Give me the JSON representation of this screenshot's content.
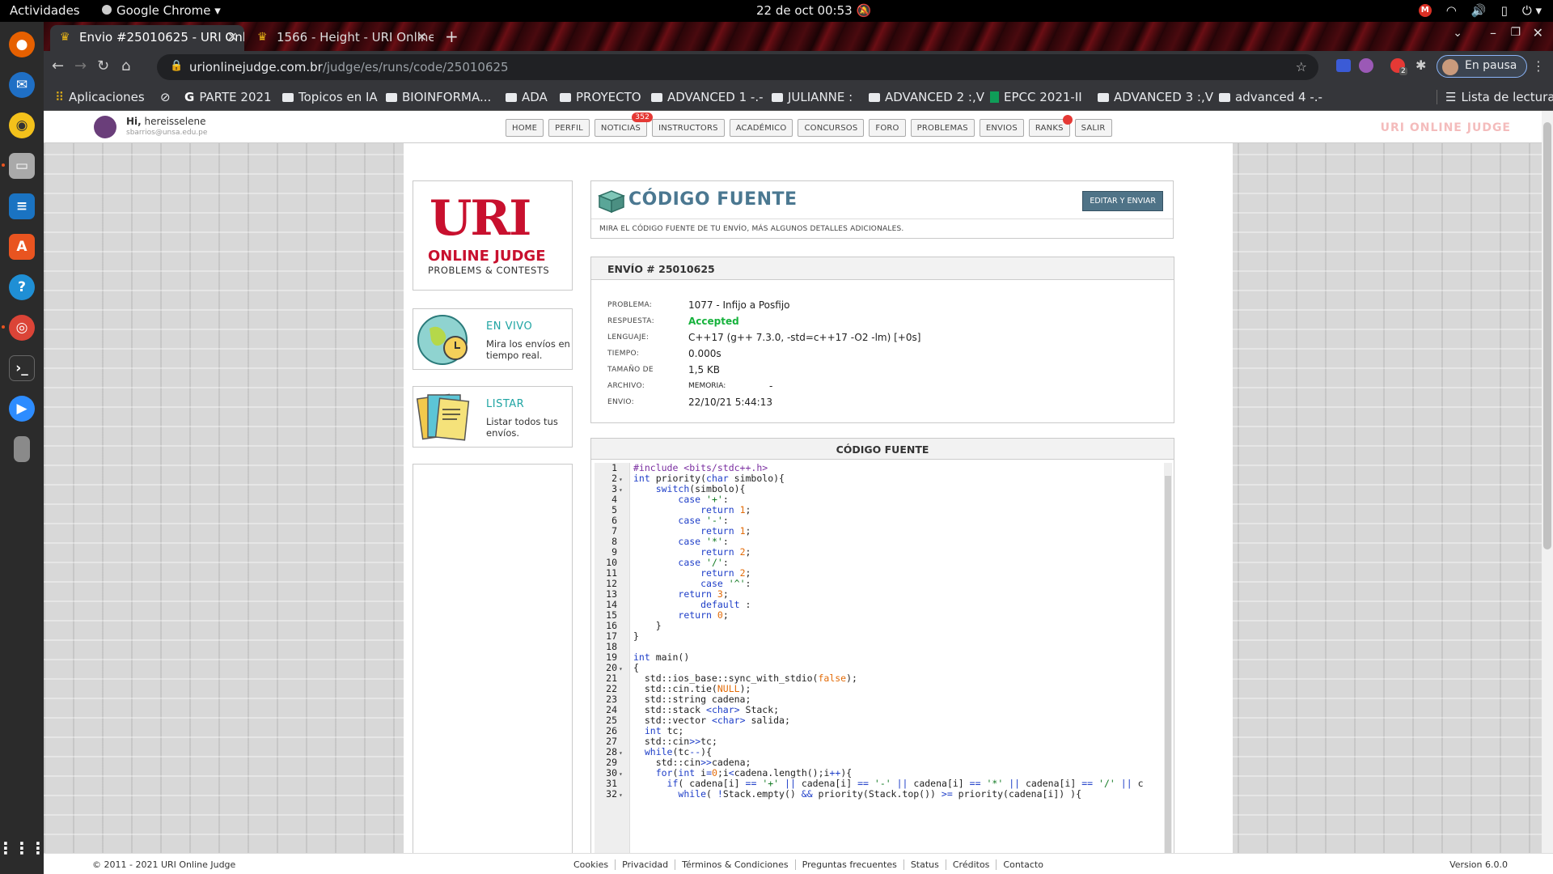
{
  "system": {
    "activities": "Actividades",
    "app_name": "Google Chrome",
    "datetime": "22 de oct  00:53"
  },
  "dock": {
    "items": [
      "firefox-icon",
      "thunderbird-icon",
      "rhythmbox-icon",
      "files-icon",
      "libreoffice-writer-icon",
      "software-icon",
      "help-icon",
      "chrome-icon",
      "terminal-icon",
      "zoom-icon",
      "removable-drive-icon",
      "show-apps-icon"
    ],
    "colors": {
      "firefox": "#e66000",
      "thunderbird": "#1f6fc5",
      "rhythmbox": "#f3c11b",
      "files": "#a9a9a9",
      "writer": "#1a73c2",
      "software": "#e95420",
      "help": "#1f8fd5",
      "chrome": "#db4437",
      "terminal": "#2e2e2e",
      "zoom": "#2d8cff",
      "drive": "#8a8a8a"
    }
  },
  "browser": {
    "tabs": [
      {
        "title": "Envio #25010625 - URI Onl",
        "active": true
      },
      {
        "title": "1566 - Height - URI Online",
        "active": false
      }
    ],
    "url_host": "urionlinejudge.com.br",
    "url_path": "/judge/es/runs/code/25010625",
    "profile_label": "En pausa",
    "extension_badge": "2",
    "bookmarks": [
      {
        "label": "Aplicaciones",
        "icon": "apps-grid-icon"
      },
      {
        "label": "",
        "icon": "globe-icon"
      },
      {
        "label": "PARTE 2021",
        "icon": "google-icon"
      },
      {
        "label": "Topicos en IA",
        "icon": "folder-icon"
      },
      {
        "label": "BIOINFORMA...",
        "icon": "folder-icon"
      },
      {
        "label": "ADA",
        "icon": "folder-icon"
      },
      {
        "label": "PROYECTO",
        "icon": "folder-icon"
      },
      {
        "label": "ADVANCED 1 -.-",
        "icon": "folder-icon"
      },
      {
        "label": "JULIANNE :",
        "icon": "folder-icon"
      },
      {
        "label": "ADVANCED 2 :,V",
        "icon": "folder-icon"
      },
      {
        "label": "EPCC 2021-II",
        "icon": "sheets-icon"
      },
      {
        "label": "ADVANCED 3 :,V",
        "icon": "folder-icon"
      },
      {
        "label": "advanced 4 -.-",
        "icon": "folder-icon"
      }
    ],
    "reading_list": "Lista de lectura"
  },
  "site": {
    "user_greeting": "Hi,",
    "username": "hereisselene",
    "email": "sbarrios@unsa.edu.pe",
    "nav": [
      "HOME",
      "PERFIL",
      "NOTICIAS",
      "INSTRUCTORS",
      "ACADÉMICO",
      "CONCURSOS",
      "FORO",
      "PROBLEMAS",
      "ENVIOS",
      "RANKS",
      "SALIR"
    ],
    "news_badge": "352",
    "brand": "URI ONLINE JUDGE",
    "logo": {
      "big": "URI",
      "line1": "ONLINE JUDGE",
      "line2": "PROBLEMS & CONTESTS"
    },
    "live": {
      "title": "EN VIVO",
      "desc": "Mira los envíos en tiempo real."
    },
    "list": {
      "title": "LISTAR",
      "desc": "Listar todos tus envíos."
    }
  },
  "code_header": {
    "title": "CÓDIGO FUENTE",
    "subtitle": "MIRA EL CÓDIGO FUENTE DE TU ENVÍO, MÁS ALGUNOS DETALLES ADICIONALES.",
    "edit_button": "EDITAR Y ENVIAR"
  },
  "submission": {
    "title": "ENVÍO # 25010625",
    "fields": [
      {
        "key": "PROBLEMA:",
        "value": "1077 - Infijo a Posfijo"
      },
      {
        "key": "RESPUESTA:",
        "value": "Accepted"
      },
      {
        "key": "LENGUAJE:",
        "value": "C++17 (g++ 7.3.0, -std=c++17 -O2 -lm) [+0s]"
      },
      {
        "key": "TIEMPO:",
        "value": "0.000s"
      },
      {
        "key": "TAMAÑO DE",
        "value": "1,5 KB"
      },
      {
        "key": "ARCHIVO:",
        "value": "MEMORIA:",
        "extra": "-"
      },
      {
        "key": "ENVIO:",
        "value": "22/10/21 5:44:13"
      }
    ],
    "accepted_color": "#16b23c"
  },
  "source": {
    "title": "CÓDIGO FUENTE",
    "lines": [
      "#include <bits/stdc++.h>",
      "int priority(char simbolo){",
      "    switch(simbolo){",
      "        case '+':",
      "            return 1;",
      "        case '-':",
      "            return 1;",
      "        case '*':",
      "            return 2;",
      "        case '/':",
      "            return 2;",
      "            case '^':",
      "        return 3;",
      "            default :",
      "        return 0;",
      "    }",
      "}",
      "",
      "int main()",
      "{",
      "  std::ios_base::sync_with_stdio(false);",
      "  std::cin.tie(NULL);",
      "  std::string cadena;",
      "  std::stack <char> Stack;",
      "  std::vector <char> salida;",
      "  int tc;",
      "  std::cin>>tc;",
      "  while(tc--){",
      "    std::cin>>cadena;",
      "    for(int i=0;i<cadena.length();i++){",
      "      if( cadena[i] == '+' || cadena[i] == '-' || cadena[i] == '*' || cadena[i] == '/' || c",
      "        while( !Stack.empty() && priority(Stack.top()) >= priority(cadena[i]) ){"
    ],
    "folds": [
      2,
      3,
      20,
      28,
      30,
      32
    ]
  },
  "footer": {
    "copyright": "© 2011 - 2021 URI Online Judge",
    "links": [
      "Cookies",
      "Privacidad",
      "Términos & Condiciones",
      "Preguntas frecuentes",
      "Status",
      "Créditos",
      "Contacto"
    ],
    "version": "Version 6.0.0"
  }
}
